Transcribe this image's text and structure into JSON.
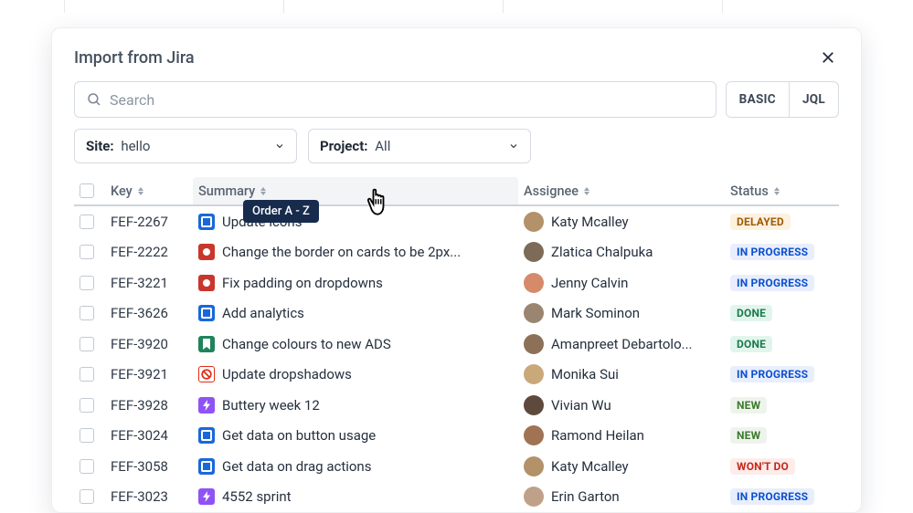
{
  "modal": {
    "title": "Import from Jira",
    "search_placeholder": "Search",
    "toggle_basic": "BASIC",
    "toggle_jql": "JQL"
  },
  "filters": {
    "site_label": "Site:",
    "site_value": "hello",
    "project_label": "Project:",
    "project_value": "All"
  },
  "columns": {
    "key": "Key",
    "summary": "Summary",
    "assignee": "Assignee",
    "status": "Status"
  },
  "tooltip": "Order A - Z",
  "status_labels": {
    "delayed": "DELAYED",
    "inprogress": "IN PROGRESS",
    "done": "DONE",
    "new": "NEW",
    "wontdo": "WON'T DO"
  },
  "rows": [
    {
      "key": "FEF-2267",
      "icon": "blue-sq",
      "summary": "Update icons",
      "assignee": "Katy Mcalley",
      "avatar_bg": "#b39169",
      "status": "delayed"
    },
    {
      "key": "FEF-2222",
      "icon": "red-dot",
      "summary": "Change the border on cards to be 2px...",
      "assignee": "Zlatica Chalpuka",
      "avatar_bg": "#7d6b58",
      "status": "inprogress"
    },
    {
      "key": "FEF-3221",
      "icon": "red-dot",
      "summary": "Fix padding on dropdowns",
      "assignee": "Jenny Calvin",
      "avatar_bg": "#d68a6a",
      "status": "inprogress"
    },
    {
      "key": "FEF-3626",
      "icon": "blue-sq",
      "summary": "Add analytics",
      "assignee": "Mark Sominon",
      "avatar_bg": "#9a8570",
      "status": "done"
    },
    {
      "key": "FEF-3920",
      "icon": "bookmark",
      "summary": "Change colours to new ADS",
      "assignee": "Amanpreet Debartolo...",
      "avatar_bg": "#8c7158",
      "status": "done"
    },
    {
      "key": "FEF-3921",
      "icon": "ban",
      "summary": "Update dropshadows",
      "assignee": "Monika Sui",
      "avatar_bg": "#c9a97a",
      "status": "inprogress"
    },
    {
      "key": "FEF-3928",
      "icon": "bolt",
      "summary": "Buttery week 12",
      "assignee": "Vivian Wu",
      "avatar_bg": "#5e4a3c",
      "status": "new"
    },
    {
      "key": "FEF-3024",
      "icon": "blue-sq",
      "summary": "Get data on button usage",
      "assignee": "Ramond Heilan",
      "avatar_bg": "#a07355",
      "status": "new"
    },
    {
      "key": "FEF-3058",
      "icon": "blue-sq",
      "summary": "Get data on drag actions",
      "assignee": "Katy Mcalley",
      "avatar_bg": "#b39169",
      "status": "wontdo"
    },
    {
      "key": "FEF-3023",
      "icon": "bolt",
      "summary": "4552 sprint",
      "assignee": "Erin Garton",
      "avatar_bg": "#bfa18a",
      "status": "inprogress"
    }
  ]
}
